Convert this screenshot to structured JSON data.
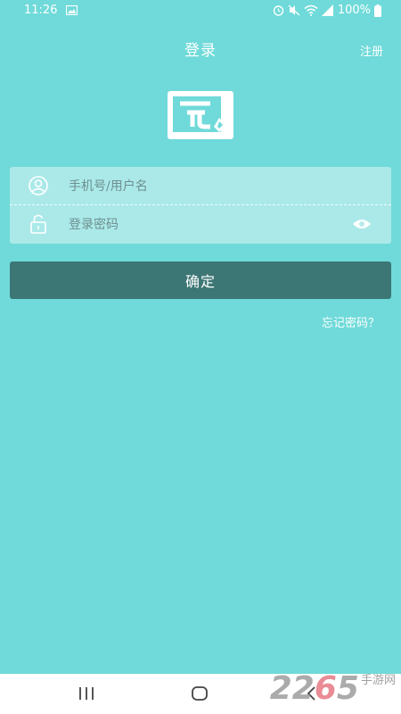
{
  "status_bar": {
    "time": "11:26",
    "battery": "100%",
    "icons": [
      "gallery-icon",
      "alarm-icon",
      "mute-icon",
      "wifi-icon",
      "signal-icon",
      "battery-icon"
    ]
  },
  "header": {
    "title": "登录",
    "register_label": "注册"
  },
  "login_form": {
    "username_placeholder": "手机号/用户名",
    "username_value": "",
    "password_placeholder": "登录密码",
    "password_value": ""
  },
  "confirm_label": "确定",
  "forgot_password_label": "忘记密码？",
  "nav_bar": {
    "buttons": [
      "recents-icon",
      "home-icon",
      "back-icon"
    ]
  },
  "watermark": {
    "number_prefix": "22",
    "number_highlight": "6",
    "number_suffix": "5",
    "text": "手游网"
  },
  "colors": {
    "background": "#6fdad9",
    "card": "#b8ecec",
    "button": "#3c7675",
    "text_light": "#ffffff"
  }
}
